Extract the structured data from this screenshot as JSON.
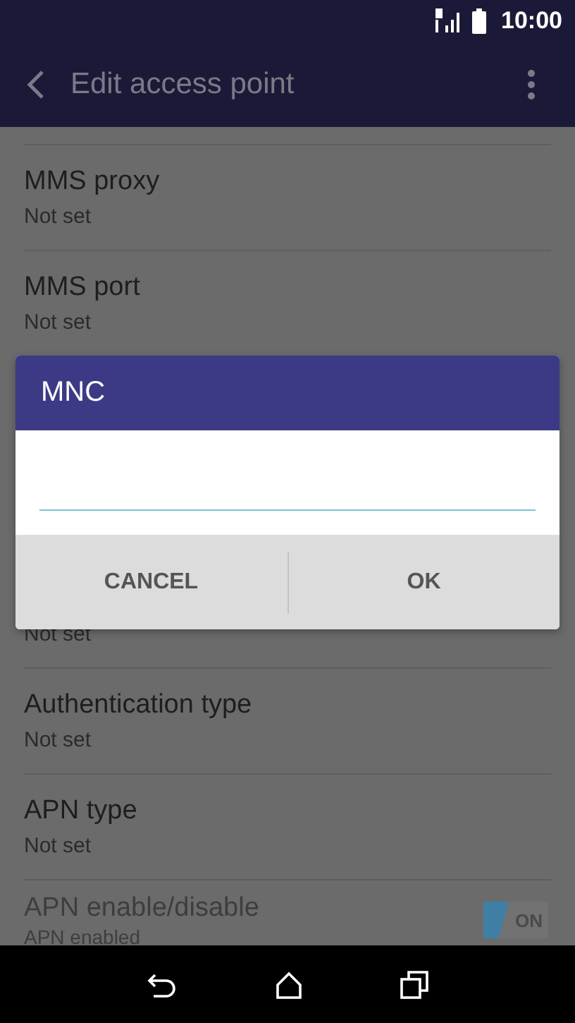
{
  "status_bar": {
    "time": "10:00"
  },
  "app_bar": {
    "title": "Edit access point"
  },
  "settings": [
    {
      "kind": "item",
      "title": "MMS proxy",
      "summary": "Not set"
    },
    {
      "kind": "item",
      "title": "MMS port",
      "summary": "Not set"
    },
    {
      "kind": "covered",
      "summary": "Not set"
    },
    {
      "kind": "item",
      "title": "Authentication type",
      "summary": "Not set"
    },
    {
      "kind": "item",
      "title": "APN type",
      "summary": "Not set"
    },
    {
      "kind": "switch",
      "title": "APN enable/disable",
      "summary": "APN enabled",
      "disabled": true,
      "on": true,
      "switch_label": "ON"
    }
  ],
  "dialog": {
    "title": "MNC",
    "buttons": [
      {
        "label": "CANCEL"
      },
      {
        "label": "OK"
      }
    ]
  }
}
